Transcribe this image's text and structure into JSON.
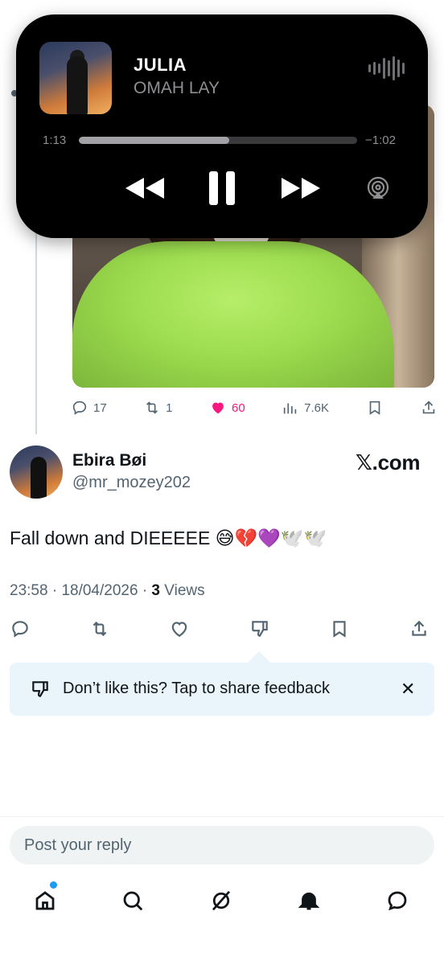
{
  "now_playing": {
    "title": "JULIA",
    "artist": "OMAH LAY",
    "elapsed": "1:13",
    "remaining": "−1:02",
    "progress_fraction": 0.54,
    "icons": [
      "waveform-icon",
      "rewind-icon",
      "pause-icon",
      "fast-forward-icon",
      "airplay-icon"
    ]
  },
  "previous_tweet": {
    "replies": "17",
    "reposts": "1",
    "likes": "60",
    "views": "7.6K",
    "like_color": "#f91880"
  },
  "tweet": {
    "author_name": "Ebira Bøi",
    "author_handle": "@mr_mozey202",
    "watermark": "𝕏.com",
    "text": "Fall down and DIEEEEE 😅💔💜🕊️🕊️",
    "time": "23:58",
    "date": "18/04/2026",
    "views_count": "3",
    "views_label": "Views"
  },
  "feedback": {
    "text": "Don’t like this? Tap to share feedback",
    "close": "✕"
  },
  "reply": {
    "placeholder": "Post your reply"
  },
  "tabs": [
    "home-icon",
    "search-icon",
    "grok-icon",
    "notifications-icon",
    "messages-icon"
  ],
  "colors": {
    "accent": "#1d9bf0",
    "text": "#0f1419",
    "muted": "#536471",
    "feedback_bg": "#eaf4fb"
  }
}
